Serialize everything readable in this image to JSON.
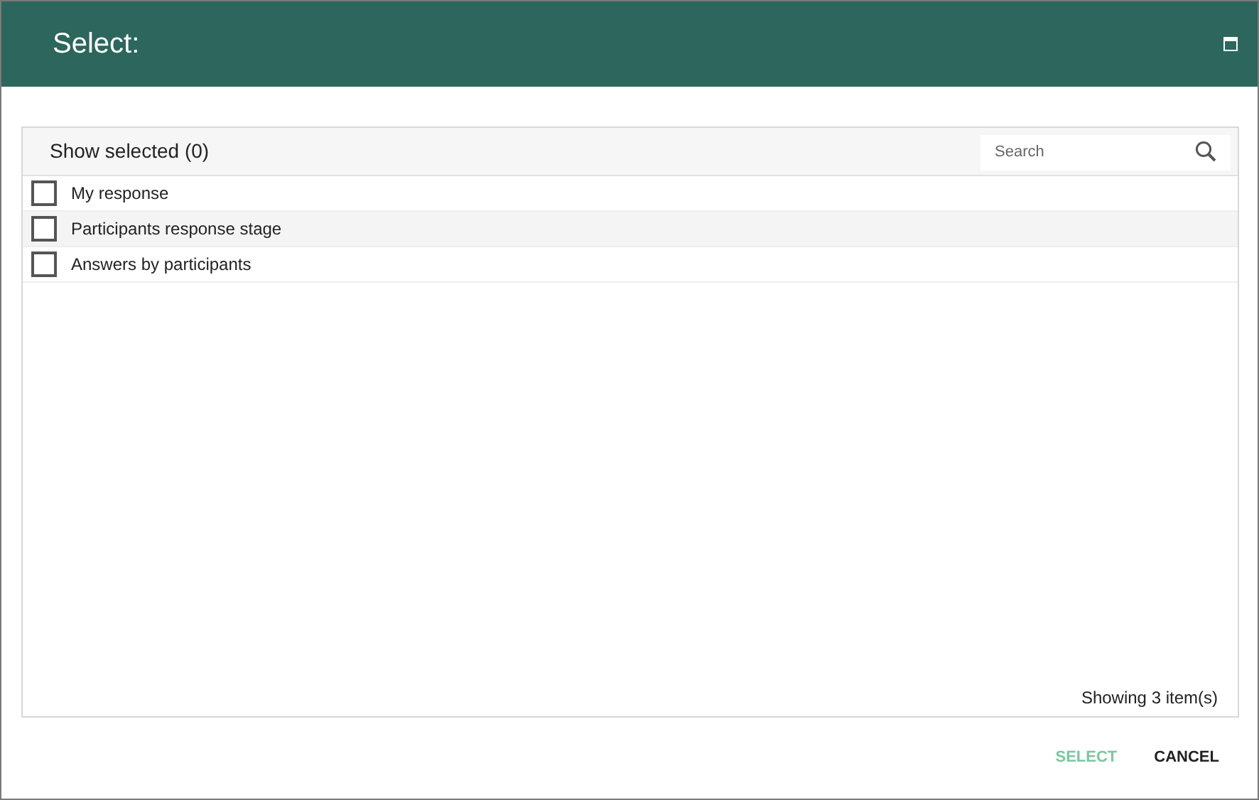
{
  "window": {
    "title": "Select:"
  },
  "toolbar": {
    "show_selected": "Show selected (0)",
    "search": {
      "placeholder": "Search"
    }
  },
  "items": [
    {
      "label": "My response",
      "checked": false
    },
    {
      "label": "Participants response stage",
      "checked": false
    },
    {
      "label": "Answers by participants",
      "checked": false
    }
  ],
  "footer": "Showing 3 item(s)",
  "buttons": [
    {
      "label": "SELECT",
      "disabled": true
    },
    {
      "label": "CANCEL",
      "disabled": false
    }
  ]
}
